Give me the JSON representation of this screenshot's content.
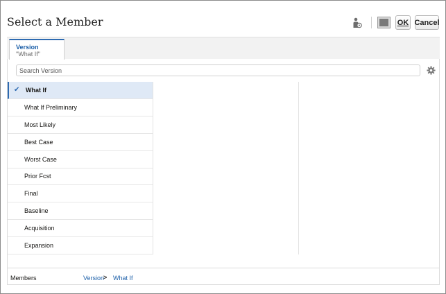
{
  "dialog": {
    "title": "Select a Member",
    "ok_label": "OK",
    "cancel_label": "Cancel"
  },
  "tab": {
    "label": "Version",
    "value": "\"What If\""
  },
  "search": {
    "placeholder": "Search Version",
    "value": ""
  },
  "members": [
    {
      "label": "What If",
      "selected": true
    },
    {
      "label": "What If Preliminary",
      "selected": false
    },
    {
      "label": "Most Likely",
      "selected": false
    },
    {
      "label": "Best Case",
      "selected": false
    },
    {
      "label": "Worst Case",
      "selected": false
    },
    {
      "label": "Prior Fcst",
      "selected": false
    },
    {
      "label": "Final",
      "selected": false
    },
    {
      "label": "Baseline",
      "selected": false
    },
    {
      "label": "Acquisition",
      "selected": false
    },
    {
      "label": "Expansion",
      "selected": false
    }
  ],
  "footer": {
    "label": "Members",
    "breadcrumb_dimension": "Version",
    "breadcrumb_separator": ">",
    "breadcrumb_member": "What If"
  },
  "icons": {
    "member_properties": "member-properties-icon",
    "display_toggle": "display-toggle-icon",
    "settings": "gear-icon",
    "selected_check": "check-icon"
  },
  "colors": {
    "accent": "#2d6ab1",
    "selected_row": "#dfe9f6",
    "link": "#1a5ea8"
  }
}
